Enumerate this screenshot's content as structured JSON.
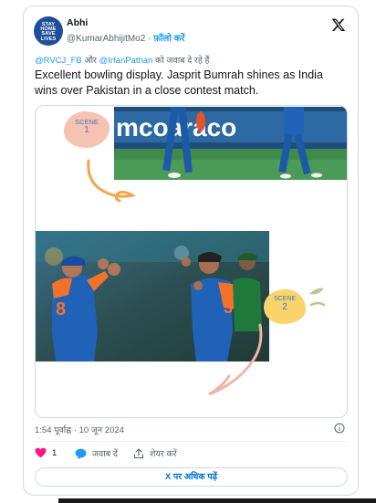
{
  "author": {
    "name": "Abhi",
    "handle": "@KumarAbhijitMo2",
    "follow_label": "फ़ॉलो करें",
    "avatar_text": [
      "STAY",
      "HOME",
      "SAVE",
      "LIVES"
    ],
    "separator": "·"
  },
  "reply_context": {
    "mention_1": "@RVCJ_FB",
    "connector": "और",
    "mention_2": "@IrfanPathan",
    "suffix": "को जवाब दे रहे हैं"
  },
  "tweet": {
    "text": "Excellent bowling display. Jasprit Bumrah shines as India wins over Pakistan in a close contest match."
  },
  "media": {
    "scene_1": {
      "word": "SCENE",
      "number": "1"
    },
    "scene_2": {
      "word": "SCENE",
      "number": "2"
    },
    "banner_text": "mcoaraco"
  },
  "meta": {
    "timestamp": "1:54 पूर्वाह्न · 10 जून 2024"
  },
  "actions": {
    "like_count": "1",
    "reply_label": "जवाब दें",
    "share_label": "शेयर करें"
  },
  "read_more_label": "X पर अधिक पढ़ें",
  "colors": {
    "link": "#1d9bf0",
    "like": "#f91880",
    "india_jersey": "#1f62b8",
    "orange": "#f2722a"
  },
  "icons": [
    "x-logo-icon",
    "heart-icon",
    "speech-bubble-icon",
    "share-icon",
    "info-icon"
  ]
}
